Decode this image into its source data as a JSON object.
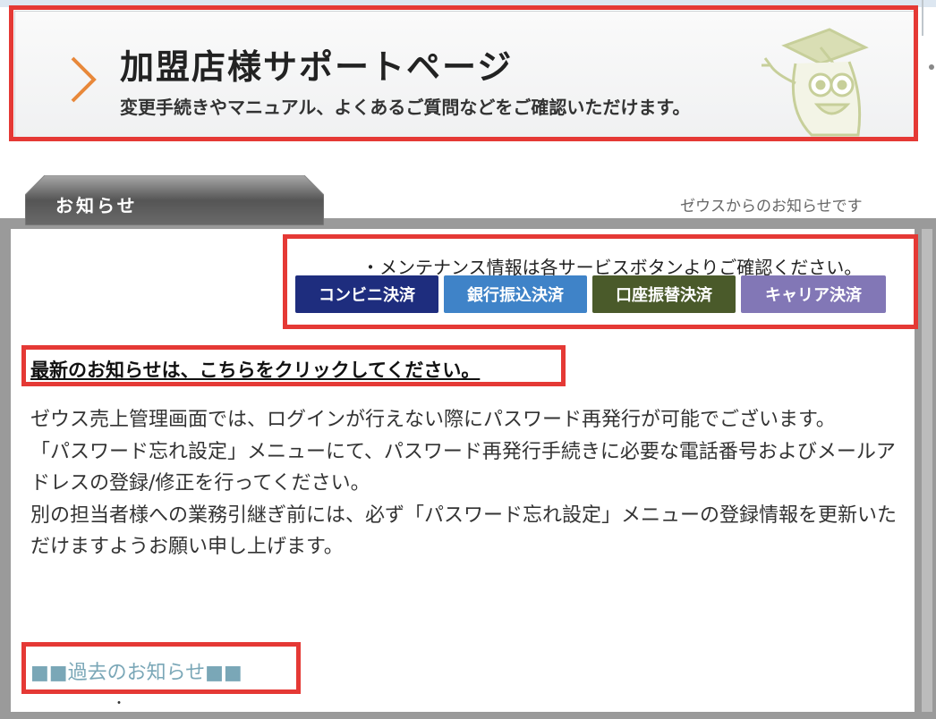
{
  "banner": {
    "title": "加盟店様サポートページ",
    "subtitle": "変更手続きやマニュアル、よくあるご質問などをご確認いただけます。",
    "chevron_color": "#e8883a"
  },
  "news": {
    "tab_label": "お知らせ",
    "caption": "ゼウスからのお知らせです",
    "maintenance_note": "・メンテナンス情報は各サービスボタンよりご確認ください。",
    "services": [
      {
        "label": "コンビニ決済",
        "color": "#1e2d7e"
      },
      {
        "label": "銀行振込決済",
        "color": "#3f83c8"
      },
      {
        "label": "口座振替決済",
        "color": "#4a5a2a"
      },
      {
        "label": "キャリア決済",
        "color": "#8277b6"
      }
    ],
    "latest_link": "最新のお知らせは、こちらをクリックしてください。",
    "paragraphs": [
      "ゼウス売上管理画面では、ログインが行えない際にパスワード再発行が可能でございます。",
      "「パスワード忘れ設定」メニューにて、パスワード再発行手続きに必要な電話番号およびメールアドレスの登録/修正を行ってください。",
      "別の担当者様への業務引継ぎ前には、必ず「パスワード忘れ設定」メニューの登録情報を更新いただけますようお願い申し上げます。"
    ],
    "past_link": "■■過去のお知らせ■■",
    "bottom_fragment": "・"
  }
}
